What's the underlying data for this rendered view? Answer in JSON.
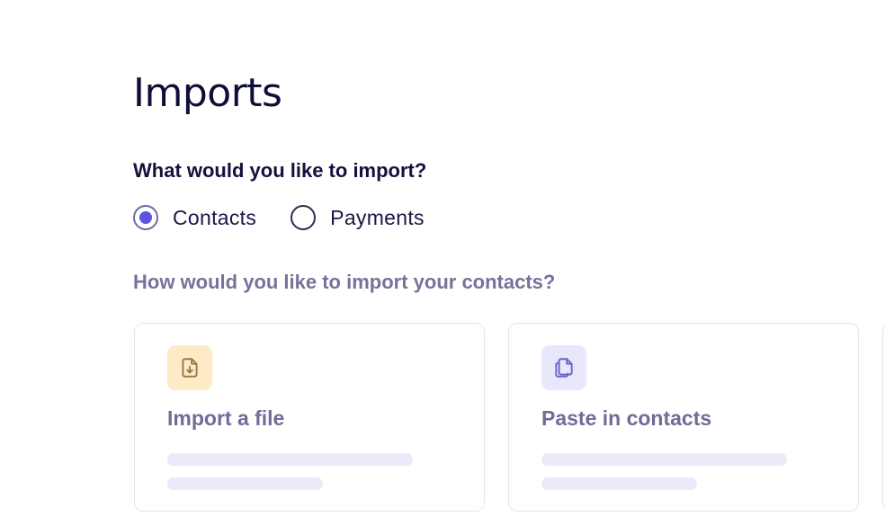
{
  "page": {
    "title": "Imports"
  },
  "import_type": {
    "question": "What would you like to import?",
    "options": [
      {
        "label": "Contacts",
        "selected": true
      },
      {
        "label": "Payments",
        "selected": false
      }
    ]
  },
  "import_method": {
    "question": "How would you like to import your contacts?",
    "cards": [
      {
        "title": "Import a file",
        "icon": "file-download-icon",
        "icon_bg": "#fdebc8",
        "icon_color": "#9a7a46"
      },
      {
        "title": "Paste in contacts",
        "icon": "copy-documents-icon",
        "icon_bg": "#e9e8fb",
        "icon_color": "#6b65cc"
      }
    ]
  },
  "colors": {
    "accent": "#5b55e0",
    "heading": "#0f0e3a",
    "muted": "#75739a"
  }
}
